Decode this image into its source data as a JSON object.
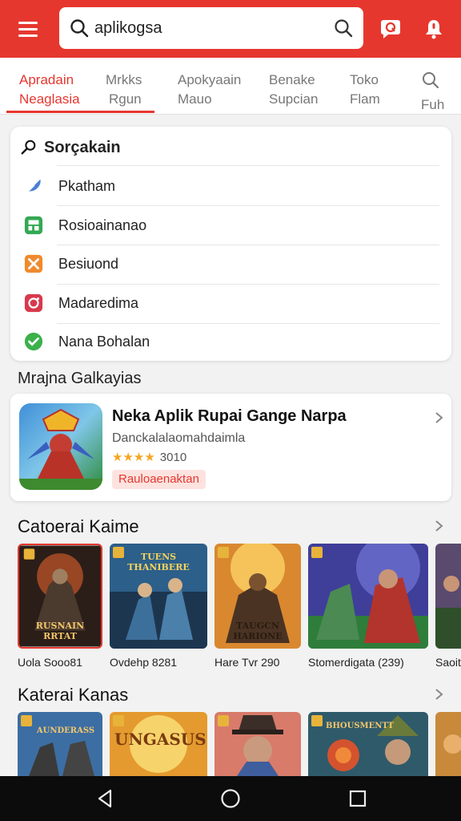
{
  "header": {
    "search_value": "aplikogsa",
    "icons": [
      "menu-icon",
      "search-icon",
      "chat-icon",
      "notification-icon"
    ],
    "accent_color": "#e6372f"
  },
  "tabs": [
    {
      "line1": "Apradain",
      "line2": "Neaglasia",
      "active": true
    },
    {
      "line1": "Mrkks",
      "line2": "Rgun",
      "active": false
    },
    {
      "line1": "Apokyaain",
      "line2": "Mauo",
      "active": false
    },
    {
      "line1": "Benake",
      "line2": "Supcian",
      "active": false
    },
    {
      "line1": "Toko",
      "line2": "Flam",
      "active": false
    },
    {
      "line1": "",
      "line2": "Fuh",
      "active": false
    }
  ],
  "suggestions": {
    "title": "Sorçakain",
    "items": [
      {
        "label": "Pkatham",
        "icon": "feather-icon"
      },
      {
        "label": "Rosioainanao",
        "icon": "store-icon"
      },
      {
        "label": "Besiuond",
        "icon": "tools-icon"
      },
      {
        "label": "Madaredima",
        "icon": "camera-icon"
      },
      {
        "label": "Nana Bohalan",
        "icon": "check-icon"
      }
    ]
  },
  "featured": {
    "section_label": "Mrajna Galkayias",
    "name": "Neka Aplik Rupai Gange Narpa",
    "subtitle": "Danckalalaomahdaimla",
    "rating_text": "3010",
    "rating_stars": 4,
    "badge": "Rauloaenaktan"
  },
  "section1": {
    "title": "Catoerai Kaime",
    "games": [
      {
        "label": "Uola Sooo81",
        "thumb_text": "RUSNAIN RRTAT"
      },
      {
        "label": "Ovdehp 8281",
        "thumb_text": "TUENS THANIBERE"
      },
      {
        "label": "Hare Tvr 290",
        "thumb_text": "TAUGCN HARIONE"
      },
      {
        "label": "Stomerdigata (239)",
        "thumb_text": ""
      },
      {
        "label": "Saoit",
        "thumb_text": ""
      }
    ]
  },
  "section2": {
    "title": "Katerai Kanas",
    "games": [
      {
        "label": "",
        "thumb_text": "AUNDERASS"
      },
      {
        "label": "",
        "thumb_text": "UNGASUS"
      },
      {
        "label": "",
        "thumb_text": ""
      },
      {
        "label": "",
        "thumb_text": "BHOUSMENTT"
      },
      {
        "label": "",
        "thumb_text": ""
      }
    ]
  },
  "navbar": {
    "buttons": [
      "back-icon",
      "home-icon",
      "recents-icon"
    ]
  }
}
